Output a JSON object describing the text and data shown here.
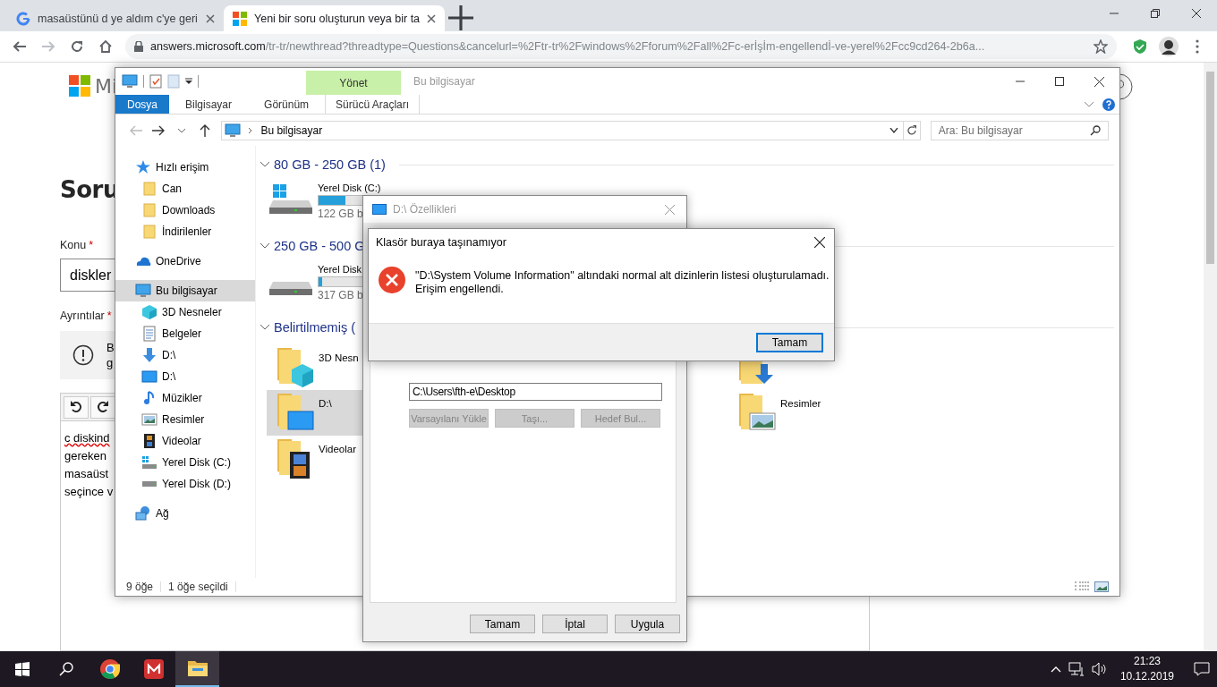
{
  "browser": {
    "tabs": [
      {
        "kind": "google",
        "title": "masaüstünü d ye aldım c'ye geri",
        "selected": false
      },
      {
        "kind": "microsoft",
        "title": "Yeni bir soru oluşturun veya bir ta",
        "selected": true
      }
    ],
    "address": {
      "host": "answers.microsoft.com",
      "path": "/tr-tr/newthread?threadtype=Questions&cancelurl=%2Ftr-tr%2Fwindows%2Fforum%2Fall%2Fc-erİşİm-engellendİ-ve-yerel%2Fcc9cd264-2b6a..."
    }
  },
  "web_page": {
    "logo_text": "Mi",
    "heading": "Soru",
    "subject": {
      "label": "Konu",
      "required_mark": "*",
      "value": "diskler"
    },
    "details": {
      "label": "Ayrıntılar",
      "required_mark": "*"
    },
    "notice_lines": [
      "B",
      "g"
    ],
    "editor_lines": [
      "c diskind",
      "gereken",
      "masaüst",
      "seçince v"
    ]
  },
  "explorer": {
    "title": "Bu bilgisayar",
    "context_group": "Yönet",
    "ribbon_tabs": [
      {
        "label": "Dosya",
        "kind": "file"
      },
      {
        "label": "Bilgisayar",
        "kind": "tab"
      },
      {
        "label": "Görünüm",
        "kind": "tab"
      },
      {
        "label": "Sürücü Araçları",
        "kind": "context"
      }
    ],
    "address_path": "Bu bilgisayar",
    "search_placeholder": "Ara: Bu bilgisayar",
    "sidebar": [
      {
        "label": "Hızlı erişim",
        "kind": "star",
        "selected": false,
        "children": [
          {
            "label": "Can",
            "kind": "folder",
            "selected": false
          },
          {
            "label": "Downloads",
            "kind": "folder",
            "selected": false
          },
          {
            "label": "İndirilenler",
            "kind": "folder",
            "selected": false
          }
        ]
      },
      {
        "label": "OneDrive",
        "kind": "cloud",
        "selected": false
      },
      {
        "label": "Bu bilgisayar",
        "kind": "computer",
        "selected": true,
        "children": [
          {
            "label": "3D Nesneler",
            "kind": "cube",
            "selected": false
          },
          {
            "label": "Belgeler",
            "kind": "document",
            "selected": false
          },
          {
            "label": "D:\\",
            "kind": "download",
            "selected": false
          },
          {
            "label": "D:\\",
            "kind": "monitor",
            "selected": false
          },
          {
            "label": "Müzikler",
            "kind": "music",
            "selected": false
          },
          {
            "label": "Resimler",
            "kind": "pictures",
            "selected": false
          },
          {
            "label": "Videolar",
            "kind": "video",
            "selected": false
          },
          {
            "label": "Yerel Disk (C:)",
            "kind": "drive-system",
            "selected": false
          },
          {
            "label": "Yerel Disk (D:)",
            "kind": "drive",
            "selected": false
          }
        ]
      },
      {
        "label": "Ağ",
        "kind": "network",
        "selected": false
      }
    ],
    "groups": [
      {
        "title": "80 GB - 250 GB (1)",
        "drives": [
          {
            "kind": "drive-system",
            "name": "Yerel Disk (C:)",
            "level": 0.16,
            "free": "122 GB b"
          }
        ]
      },
      {
        "title": "250 GB - 500 G",
        "drives": [
          {
            "kind": "drive",
            "name": "Yerel Disk",
            "level": 0.02,
            "free": "317 GB b"
          }
        ]
      },
      {
        "title": "Belirtilmemiş (",
        "folders": [
          {
            "label": "3D Nesn",
            "kind": "cube",
            "selected": false
          },
          {
            "kind": "download",
            "selected": false
          },
          {
            "label": "D:\\",
            "kind": "monitor",
            "selected": true
          },
          {
            "label": "Resimler",
            "kind": "pictures",
            "selected": false
          },
          {
            "label": "Videolar",
            "kind": "video",
            "selected": false
          }
        ]
      }
    ],
    "status": {
      "count": "9 öğe",
      "selection": "1 öğe seçildi"
    }
  },
  "properties_dialog": {
    "title": "D:\\ Özellikleri",
    "active": false,
    "target_path": "C:\\Users\\fth-e\\Desktop",
    "actions": [
      {
        "label": "Varsayılanı Yükle",
        "disabled": true
      },
      {
        "label": "Taşı...",
        "disabled": true
      },
      {
        "label": "Hedef Bul...",
        "disabled": true
      }
    ],
    "buttons": [
      {
        "label": "Tamam",
        "disabled": false
      },
      {
        "label": "İptal",
        "disabled": false
      },
      {
        "label": "Uygula",
        "disabled": false
      }
    ]
  },
  "error_dialog": {
    "title": "Klasör buraya taşınamıyor",
    "active": true,
    "kind": "error",
    "message": [
      "\"D:\\System Volume Information\" altındaki normal alt dizinlerin listesi oluşturulamadı.",
      "Erişim engellendi."
    ],
    "buttons": [
      {
        "label": "Tamam",
        "default": true
      }
    ]
  },
  "taskbar": {
    "apps": [
      {
        "kind": "chrome",
        "selected": false
      },
      {
        "kind": "app",
        "selected": false
      },
      {
        "kind": "file-explorer",
        "selected": true
      }
    ],
    "time": "21:23",
    "date": "10.12.2019"
  }
}
